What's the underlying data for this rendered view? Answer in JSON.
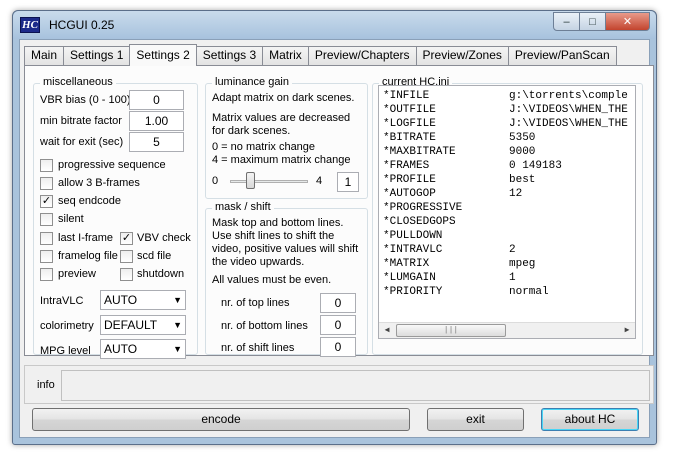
{
  "window": {
    "app_icon_text": "HC",
    "title": "HCGUI 0.25",
    "minimize_glyph": "–",
    "maximize_glyph": "□",
    "close_glyph": "✕"
  },
  "tabs": [
    "Main",
    "Settings 1",
    "Settings 2",
    "Settings 3",
    "Matrix",
    "Preview/Chapters",
    "Preview/Zones",
    "Preview/PanScan"
  ],
  "active_tab": "Settings 2",
  "miscellaneous": {
    "title": "miscellaneous",
    "vbr_bias_label": "VBR bias (0 - 100)",
    "vbr_bias_value": "0",
    "min_bitrate_factor_label": "min bitrate factor",
    "min_bitrate_factor_value": "1.00",
    "wait_for_exit_label": "wait for exit (sec)",
    "wait_for_exit_value": "5",
    "progressive_sequence": "progressive sequence",
    "allow_3_bframes": "allow 3 B-frames",
    "seq_endcode": "seq endcode",
    "silent": "silent",
    "last_iframe": "last I-frame",
    "vbv_check": "VBV check",
    "framelog_file": "framelog file",
    "scd_file": "scd file",
    "preview": "preview",
    "shutdown": "shutdown",
    "checked_glyph": "✓",
    "intravlc_label": "IntraVLC",
    "intravlc_value": "AUTO",
    "colorimetry_label": "colorimetry",
    "colorimetry_value": "DEFAULT",
    "mpg_level_label": "MPG level",
    "mpg_level_value": "AUTO",
    "dropdown_glyph": "▼"
  },
  "luminance": {
    "title": "luminance gain",
    "desc1": "Adapt matrix on dark scenes.",
    "desc2": "Matrix values are decreased for dark scenes.",
    "desc3": "0 = no matrix change",
    "desc4": "4 = maximum matrix change",
    "slider_min": "0",
    "slider_max": "4",
    "slider_value": "1"
  },
  "mask_shift": {
    "title": "mask / shift",
    "desc1": "Mask top and bottom lines. Use shift lines to shift the video, positive values will shift the video upwards.",
    "desc2": "All values must be even.",
    "top_lines_label": "nr. of top lines",
    "top_lines_value": "0",
    "bottom_lines_label": "nr. of bottom lines",
    "bottom_lines_value": "0",
    "shift_lines_label": "nr. of shift lines",
    "shift_lines_value": "0"
  },
  "current_ini": {
    "title": "current HC.ini",
    "rows": [
      {
        "key": "*INFILE",
        "value": "g:\\torrents\\comple"
      },
      {
        "key": "*OUTFILE",
        "value": "J:\\VIDEOS\\WHEN_THE"
      },
      {
        "key": "*LOGFILE",
        "value": "J:\\VIDEOS\\WHEN_THE"
      },
      {
        "key": "*BITRATE",
        "value": "5350"
      },
      {
        "key": "*MAXBITRATE",
        "value": "9000"
      },
      {
        "key": "*FRAMES",
        "value": "0 149183"
      },
      {
        "key": "*PROFILE",
        "value": "best"
      },
      {
        "key": "*AUTOGOP",
        "value": "12"
      },
      {
        "key": "*PROGRESSIVE",
        "value": ""
      },
      {
        "key": "*CLOSEDGOPS",
        "value": ""
      },
      {
        "key": "*PULLDOWN",
        "value": ""
      },
      {
        "key": "*INTRAVLC",
        "value": "2"
      },
      {
        "key": "*MATRIX",
        "value": "mpeg"
      },
      {
        "key": "*LUMGAIN",
        "value": "1"
      },
      {
        "key": "*PRIORITY",
        "value": "normal"
      }
    ],
    "scroll_left_glyph": "◀",
    "scroll_right_glyph": "▶",
    "thumb_grip": "|||"
  },
  "info": {
    "label": "info",
    "value": ""
  },
  "buttons": {
    "encode": "encode",
    "exit": "exit",
    "about": "about HC"
  }
}
